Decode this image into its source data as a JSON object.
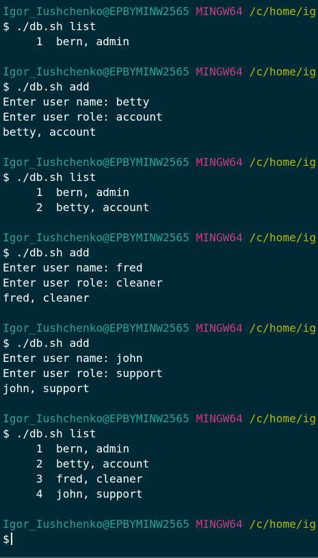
{
  "colors": {
    "background": "#002b36",
    "user_host": "#2aa198",
    "environment": "#d33682",
    "path": "#b9b900",
    "text": "#ffffff"
  },
  "prompt": {
    "user_host": "Igor_Iushchenko@EPBYMINW2565",
    "environment": "MINGW64",
    "path": "/c/home/ig",
    "symbol": "$"
  },
  "blocks": [
    {
      "command": "./db.sh list",
      "output": [
        "     1  bern, admin"
      ]
    },
    {
      "command": "./db.sh add",
      "output": [
        "Enter user name: betty",
        "Enter user role: account",
        "betty, account"
      ]
    },
    {
      "command": "./db.sh list",
      "output": [
        "     1  bern, admin",
        "     2  betty, account"
      ]
    },
    {
      "command": "./db.sh add",
      "output": [
        "Enter user name: fred",
        "Enter user role: cleaner",
        "fred, cleaner"
      ]
    },
    {
      "command": "./db.sh add",
      "output": [
        "Enter user name: john",
        "Enter user role: support",
        "john, support"
      ]
    },
    {
      "command": "./db.sh list",
      "output": [
        "     1  bern, admin",
        "     2  betty, account",
        "     3  fred, cleaner",
        "     4  john, support"
      ]
    }
  ],
  "current_input": ""
}
